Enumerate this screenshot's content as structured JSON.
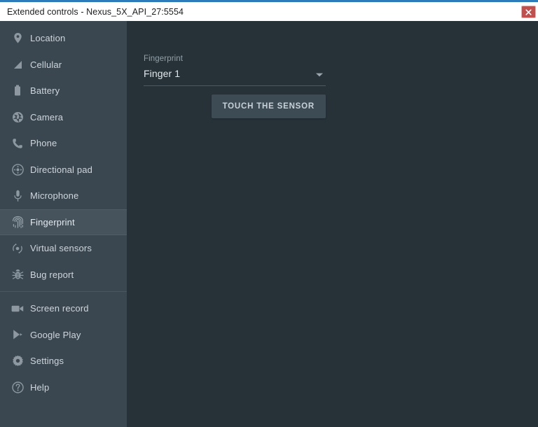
{
  "titlebar": {
    "title": "Extended controls - Nexus_5X_API_27:5554",
    "close_label": "x",
    "close_icon": "close-icon",
    "accent_color": "#2b7cb8",
    "close_color": "#c0504d"
  },
  "sidebar": {
    "groups": [
      {
        "items": [
          {
            "label": "Location",
            "icon": "location-pin-icon",
            "selected": false
          },
          {
            "label": "Cellular",
            "icon": "cellular-signal-icon",
            "selected": false
          },
          {
            "label": "Battery",
            "icon": "battery-icon",
            "selected": false
          },
          {
            "label": "Camera",
            "icon": "camera-aperture-icon",
            "selected": false
          },
          {
            "label": "Phone",
            "icon": "phone-handset-icon",
            "selected": false
          },
          {
            "label": "Directional pad",
            "icon": "directional-pad-icon",
            "selected": false
          },
          {
            "label": "Microphone",
            "icon": "microphone-icon",
            "selected": false
          },
          {
            "label": "Fingerprint",
            "icon": "fingerprint-icon",
            "selected": true
          },
          {
            "label": "Virtual sensors",
            "icon": "virtual-sensors-icon",
            "selected": false
          },
          {
            "label": "Bug report",
            "icon": "bug-report-icon",
            "selected": false
          }
        ]
      },
      {
        "items": [
          {
            "label": "Screen record",
            "icon": "video-camera-icon",
            "selected": false
          },
          {
            "label": "Google Play",
            "icon": "google-play-icon",
            "selected": false
          },
          {
            "label": "Settings",
            "icon": "gear-icon",
            "selected": false
          },
          {
            "label": "Help",
            "icon": "help-question-icon",
            "selected": false
          }
        ]
      }
    ],
    "background_color": "#3a4750",
    "selected_color": "#46535c"
  },
  "main": {
    "fingerprint_label": "Fingerprint",
    "finger_select": {
      "value": "Finger 1",
      "arrow_icon": "chevron-down-icon"
    },
    "touch_sensor_button": "TOUCH THE SENSOR",
    "background_color": "#273238"
  }
}
